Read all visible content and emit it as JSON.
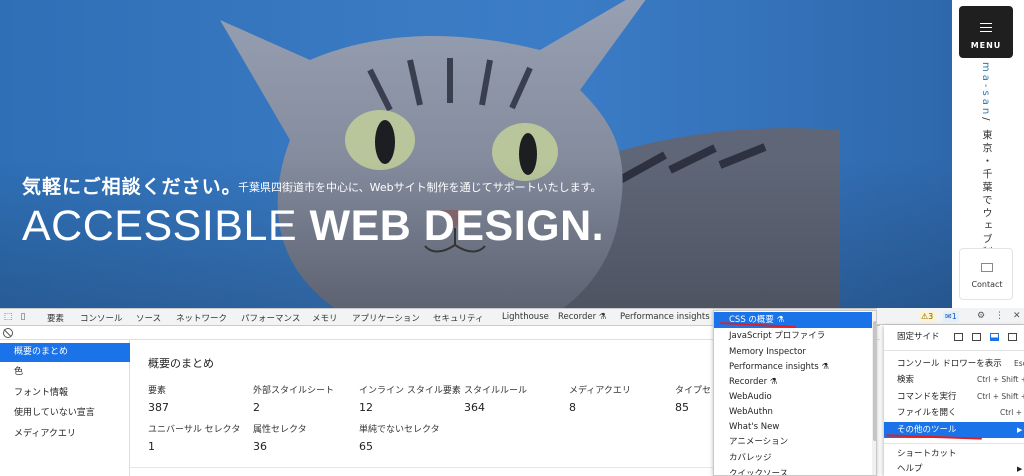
{
  "hero": {
    "catch_jp": "気軽にご相談ください。",
    "sub": "千葉県四街道市を中心に、Webサイト制作を通じてサポートいたします。",
    "title_light": "ACCESSIBLE",
    "title_bold": "WEB DESIGN.",
    "bg_color": "#3a7bc4"
  },
  "side": {
    "menu_label": "MENU",
    "brand": "ma-san",
    "tagline": "/ 東京・千葉でウェブ制作",
    "contact_label": "Contact"
  },
  "devtools": {
    "tabs": [
      "要素",
      "コンソール",
      "ソース",
      "ネットワーク",
      "パフォーマンス",
      "メモリ",
      "アプリケーション",
      "セキュリティ",
      "Lighthouse",
      "Recorder ⚗",
      "Performance insights ⚗"
    ],
    "nav": [
      "概要のまとめ",
      "色",
      "フォント情報",
      "使用していない宣言",
      "メディアクエリ"
    ],
    "panel_title": "概要のまとめ",
    "stats_row1": [
      {
        "label": "要素",
        "value": "387"
      },
      {
        "label": "外部スタイルシート",
        "value": "2"
      },
      {
        "label": "インライン スタイル要素",
        "value": "12"
      },
      {
        "label": "スタイルルール",
        "value": "364"
      },
      {
        "label": "メディアクエリ",
        "value": "8"
      },
      {
        "label": "タイプセレ",
        "value": "85"
      }
    ],
    "stats_row2": [
      {
        "label": "ユニバーサル セレクタ",
        "value": "1"
      },
      {
        "label": "属性セレクタ",
        "value": "36"
      },
      {
        "label": "単純でないセレクタ",
        "value": "65"
      }
    ],
    "badges": {
      "warnings": "3",
      "messages": "1"
    }
  },
  "more_tools": [
    "CSS の概要 ⚗",
    "JavaScript プロファイラ",
    "Memory Inspector",
    "Performance insights ⚗",
    "Recorder ⚗",
    "WebAudio",
    "WebAuthn",
    "What's New",
    "アニメーション",
    "カバレッジ",
    "クイックソース"
  ],
  "main_menu": {
    "dock_label": "固定サイド",
    "items": [
      {
        "label": "コンソール ドロワーを表示",
        "shortcut": "Esc"
      },
      {
        "label": "検索",
        "shortcut": "Ctrl + Shift + F"
      },
      {
        "label": "コマンドを実行",
        "shortcut": "Ctrl + Shift + P"
      },
      {
        "label": "ファイルを開く",
        "shortcut": "Ctrl + P"
      },
      {
        "label": "その他のツール",
        "shortcut": ""
      },
      {
        "label": "ショートカット",
        "shortcut": ""
      },
      {
        "label": "ヘルプ",
        "shortcut": ""
      }
    ]
  },
  "colors": {
    "accent": "#1a73e8",
    "annotation": "#e02020"
  }
}
